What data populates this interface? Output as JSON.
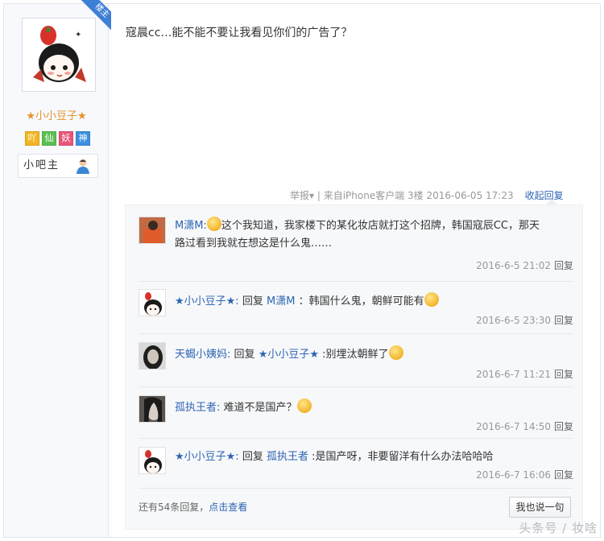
{
  "author": {
    "badge": "楼主",
    "name": "★小小豆子★",
    "levels": [
      {
        "char": "吖",
        "color": "#f2b622"
      },
      {
        "char": "仙",
        "color": "#5bbf52"
      },
      {
        "char": "妖",
        "color": "#e9567a"
      },
      {
        "char": "神",
        "color": "#3d8fe0"
      }
    ],
    "role": "小吧主"
  },
  "post": {
    "text": "寇晨cc…能不能不要让我看见你们的广告了？",
    "meta": "举报▾ | 来自iPhone客户端 3楼 2016-06-05 17:23",
    "collapse": "收起回复"
  },
  "replies": [
    {
      "user": "M潇M:",
      "text_lines": [
        "这个我知道，我家楼下的某化妆店就打这个招牌，韩国寇辰CC，那天",
        "路过看到我就在想这是什么鬼……"
      ],
      "time": "2016-6-5 21:02",
      "reply_label": "回复"
    },
    {
      "user": "★小小豆子★:",
      "prefix": "回复",
      "target": "M潇M",
      "text": "：韩国什么鬼，朝鲜可能有",
      "time": "2016-6-5 23:30",
      "reply_label": "回复"
    },
    {
      "user": "天蝎小姨妈:",
      "prefix": "回复",
      "target": "★小小豆子★",
      "text": ":别埋汰朝鲜了",
      "time": "2016-6-7 11:21",
      "reply_label": "回复"
    },
    {
      "user": "孤执王者:",
      "text": "难道不是国产？",
      "time": "2016-6-7 14:50",
      "reply_label": "回复"
    },
    {
      "user": "★小小豆子★:",
      "prefix": "回复",
      "target": "孤执王者",
      "text": ":是国产呀，非要留洋有什么办法哈哈哈",
      "time": "2016-6-7 16:06",
      "reply_label": "回复"
    }
  ],
  "footer": {
    "more_prefix": "还有54条回复，",
    "more_link": "点击查看",
    "say_button": "我也说一句"
  },
  "watermark": "头条号 / 妆啥"
}
